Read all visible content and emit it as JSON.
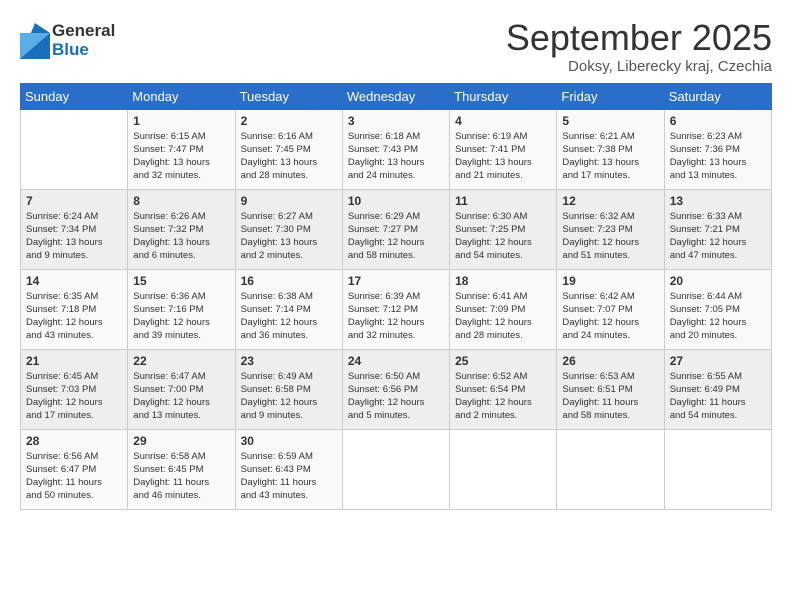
{
  "logo": {
    "general": "General",
    "blue": "Blue"
  },
  "title": "September 2025",
  "subtitle": "Doksy, Liberecky kraj, Czechia",
  "header": {
    "days": [
      "Sunday",
      "Monday",
      "Tuesday",
      "Wednesday",
      "Thursday",
      "Friday",
      "Saturday"
    ]
  },
  "weeks": [
    [
      {
        "day": "",
        "detail": ""
      },
      {
        "day": "1",
        "detail": "Sunrise: 6:15 AM\nSunset: 7:47 PM\nDaylight: 13 hours\nand 32 minutes."
      },
      {
        "day": "2",
        "detail": "Sunrise: 6:16 AM\nSunset: 7:45 PM\nDaylight: 13 hours\nand 28 minutes."
      },
      {
        "day": "3",
        "detail": "Sunrise: 6:18 AM\nSunset: 7:43 PM\nDaylight: 13 hours\nand 24 minutes."
      },
      {
        "day": "4",
        "detail": "Sunrise: 6:19 AM\nSunset: 7:41 PM\nDaylight: 13 hours\nand 21 minutes."
      },
      {
        "day": "5",
        "detail": "Sunrise: 6:21 AM\nSunset: 7:38 PM\nDaylight: 13 hours\nand 17 minutes."
      },
      {
        "day": "6",
        "detail": "Sunrise: 6:23 AM\nSunset: 7:36 PM\nDaylight: 13 hours\nand 13 minutes."
      }
    ],
    [
      {
        "day": "7",
        "detail": "Sunrise: 6:24 AM\nSunset: 7:34 PM\nDaylight: 13 hours\nand 9 minutes."
      },
      {
        "day": "8",
        "detail": "Sunrise: 6:26 AM\nSunset: 7:32 PM\nDaylight: 13 hours\nand 6 minutes."
      },
      {
        "day": "9",
        "detail": "Sunrise: 6:27 AM\nSunset: 7:30 PM\nDaylight: 13 hours\nand 2 minutes."
      },
      {
        "day": "10",
        "detail": "Sunrise: 6:29 AM\nSunset: 7:27 PM\nDaylight: 12 hours\nand 58 minutes."
      },
      {
        "day": "11",
        "detail": "Sunrise: 6:30 AM\nSunset: 7:25 PM\nDaylight: 12 hours\nand 54 minutes."
      },
      {
        "day": "12",
        "detail": "Sunrise: 6:32 AM\nSunset: 7:23 PM\nDaylight: 12 hours\nand 51 minutes."
      },
      {
        "day": "13",
        "detail": "Sunrise: 6:33 AM\nSunset: 7:21 PM\nDaylight: 12 hours\nand 47 minutes."
      }
    ],
    [
      {
        "day": "14",
        "detail": "Sunrise: 6:35 AM\nSunset: 7:18 PM\nDaylight: 12 hours\nand 43 minutes."
      },
      {
        "day": "15",
        "detail": "Sunrise: 6:36 AM\nSunset: 7:16 PM\nDaylight: 12 hours\nand 39 minutes."
      },
      {
        "day": "16",
        "detail": "Sunrise: 6:38 AM\nSunset: 7:14 PM\nDaylight: 12 hours\nand 36 minutes."
      },
      {
        "day": "17",
        "detail": "Sunrise: 6:39 AM\nSunset: 7:12 PM\nDaylight: 12 hours\nand 32 minutes."
      },
      {
        "day": "18",
        "detail": "Sunrise: 6:41 AM\nSunset: 7:09 PM\nDaylight: 12 hours\nand 28 minutes."
      },
      {
        "day": "19",
        "detail": "Sunrise: 6:42 AM\nSunset: 7:07 PM\nDaylight: 12 hours\nand 24 minutes."
      },
      {
        "day": "20",
        "detail": "Sunrise: 6:44 AM\nSunset: 7:05 PM\nDaylight: 12 hours\nand 20 minutes."
      }
    ],
    [
      {
        "day": "21",
        "detail": "Sunrise: 6:45 AM\nSunset: 7:03 PM\nDaylight: 12 hours\nand 17 minutes."
      },
      {
        "day": "22",
        "detail": "Sunrise: 6:47 AM\nSunset: 7:00 PM\nDaylight: 12 hours\nand 13 minutes."
      },
      {
        "day": "23",
        "detail": "Sunrise: 6:49 AM\nSunset: 6:58 PM\nDaylight: 12 hours\nand 9 minutes."
      },
      {
        "day": "24",
        "detail": "Sunrise: 6:50 AM\nSunset: 6:56 PM\nDaylight: 12 hours\nand 5 minutes."
      },
      {
        "day": "25",
        "detail": "Sunrise: 6:52 AM\nSunset: 6:54 PM\nDaylight: 12 hours\nand 2 minutes."
      },
      {
        "day": "26",
        "detail": "Sunrise: 6:53 AM\nSunset: 6:51 PM\nDaylight: 11 hours\nand 58 minutes."
      },
      {
        "day": "27",
        "detail": "Sunrise: 6:55 AM\nSunset: 6:49 PM\nDaylight: 11 hours\nand 54 minutes."
      }
    ],
    [
      {
        "day": "28",
        "detail": "Sunrise: 6:56 AM\nSunset: 6:47 PM\nDaylight: 11 hours\nand 50 minutes."
      },
      {
        "day": "29",
        "detail": "Sunrise: 6:58 AM\nSunset: 6:45 PM\nDaylight: 11 hours\nand 46 minutes."
      },
      {
        "day": "30",
        "detail": "Sunrise: 6:59 AM\nSunset: 6:43 PM\nDaylight: 11 hours\nand 43 minutes."
      },
      {
        "day": "",
        "detail": ""
      },
      {
        "day": "",
        "detail": ""
      },
      {
        "day": "",
        "detail": ""
      },
      {
        "day": "",
        "detail": ""
      }
    ]
  ]
}
